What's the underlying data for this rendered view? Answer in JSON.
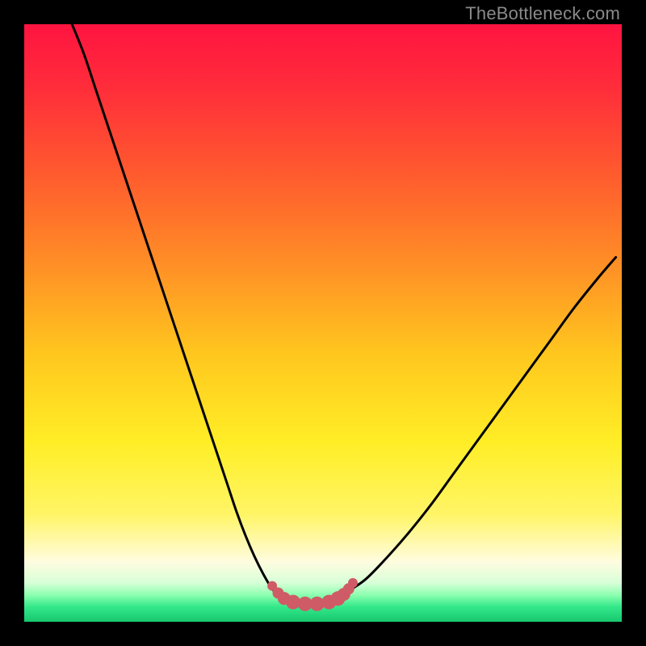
{
  "watermark": "TheBottleneck.com",
  "colors": {
    "black": "#000000",
    "curve": "#000000",
    "markers": "#cf5b66",
    "gradient_stops": [
      {
        "offset": 0.0,
        "color": "#ff1440"
      },
      {
        "offset": 0.1,
        "color": "#ff2b3b"
      },
      {
        "offset": 0.25,
        "color": "#ff5a2e"
      },
      {
        "offset": 0.4,
        "color": "#ff8e26"
      },
      {
        "offset": 0.55,
        "color": "#ffc61e"
      },
      {
        "offset": 0.7,
        "color": "#ffee26"
      },
      {
        "offset": 0.82,
        "color": "#fff566"
      },
      {
        "offset": 0.9,
        "color": "#fffce0"
      },
      {
        "offset": 0.935,
        "color": "#d7ffd7"
      },
      {
        "offset": 0.955,
        "color": "#8dffb0"
      },
      {
        "offset": 0.975,
        "color": "#33e88a"
      },
      {
        "offset": 1.0,
        "color": "#18c76e"
      }
    ]
  },
  "chart_data": {
    "type": "line",
    "title": "",
    "xlabel": "",
    "ylabel": "",
    "xlim": [
      0,
      100
    ],
    "ylim": [
      0,
      100
    ],
    "series": [
      {
        "name": "bottleneck-curve",
        "x": [
          8,
          10,
          12,
          14,
          16,
          18,
          20,
          22,
          24,
          26,
          28,
          30,
          32,
          34,
          35.5,
          37,
          38.5,
          40,
          41.5,
          43,
          44.5,
          46,
          48,
          50,
          52,
          54,
          57,
          60,
          64,
          68,
          72,
          76,
          80,
          84,
          88,
          92,
          96,
          99
        ],
        "y": [
          100,
          95,
          89,
          83,
          77,
          71,
          65,
          59,
          53,
          47,
          41,
          35,
          29,
          23,
          18.5,
          14.5,
          11,
          8,
          5.5,
          4,
          3.2,
          3,
          3,
          3.2,
          3.8,
          5,
          7,
          10,
          14.5,
          19.5,
          25,
          30.5,
          36,
          41.5,
          47,
          52.5,
          57.5,
          61
        ]
      }
    ],
    "markers": {
      "name": "trough-markers",
      "x": [
        41.5,
        42.5,
        43.5,
        45,
        47,
        49,
        51,
        52.5,
        53.5,
        54.3,
        55
      ],
      "y": [
        6.0,
        4.8,
        3.9,
        3.3,
        3.0,
        3.0,
        3.3,
        3.9,
        4.6,
        5.5,
        6.5
      ],
      "r": [
        6,
        7,
        8,
        9,
        9,
        9,
        9,
        9,
        8,
        7,
        6
      ]
    }
  }
}
